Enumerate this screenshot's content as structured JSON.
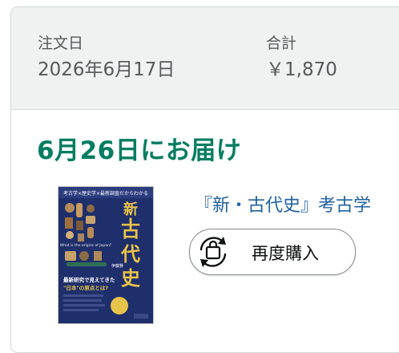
{
  "order": {
    "date_label": "注文日",
    "date_value": "2026年6月17日",
    "total_label": "合計",
    "total_value": "￥1,870"
  },
  "shipment": {
    "delivery_status": "6月26日にお届け"
  },
  "product": {
    "title": "『新・古代史』考古学",
    "cover": {
      "top_text": "考古学×歴史学×最新調査だからわかる",
      "title_chars": [
        "新",
        "古",
        "代",
        "史"
      ],
      "en_subtitle": "What is the origins of Japan?",
      "author": "伊藤賢",
      "bottom_line1": "最新研究で見えてきた",
      "bottom_line2": "\"日本\"の原点とは?"
    },
    "rebuy_label": "再度購入",
    "rebuy_icon": "bag-refresh-icon"
  },
  "colors": {
    "delivery_green": "#067d62",
    "link_blue": "#2162a1",
    "header_bg": "#f0f2f2",
    "cover_navy": "#1f2f6b",
    "cover_gold": "#e8c34a"
  }
}
